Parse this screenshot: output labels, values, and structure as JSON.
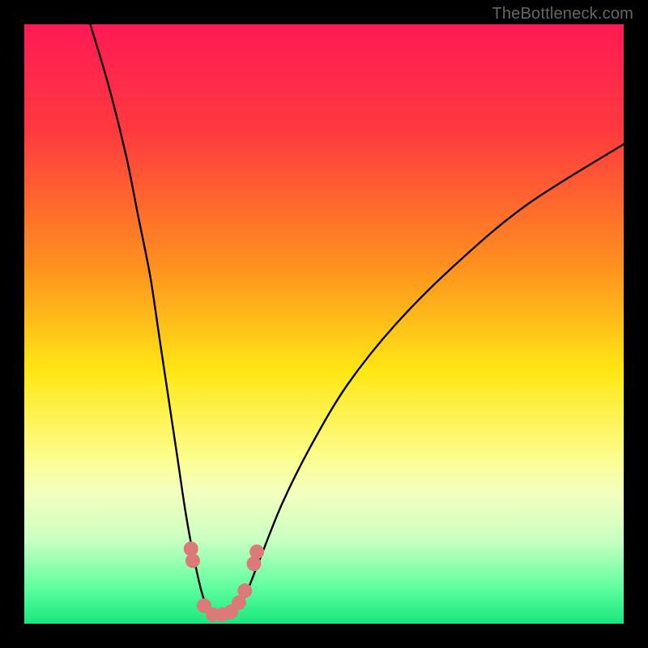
{
  "watermark": "TheBottleneck.com",
  "chart_data": {
    "type": "line",
    "title": "",
    "xlabel": "",
    "ylabel": "",
    "xlim": [
      0,
      100
    ],
    "ylim": [
      0,
      100
    ],
    "gradient_stops": [
      {
        "offset": 0,
        "color": "#ff1a55"
      },
      {
        "offset": 18,
        "color": "#ff3a3f"
      },
      {
        "offset": 40,
        "color": "#ff8f1f"
      },
      {
        "offset": 58,
        "color": "#ffe714"
      },
      {
        "offset": 72,
        "color": "#fdfd8a"
      },
      {
        "offset": 78,
        "color": "#f4ffbf"
      },
      {
        "offset": 86,
        "color": "#caffc2"
      },
      {
        "offset": 94,
        "color": "#5eff9d"
      },
      {
        "offset": 100,
        "color": "#17e87c"
      }
    ],
    "series": [
      {
        "name": "bottleneck-curve",
        "points": [
          {
            "x": 11.0,
            "y": 100.0
          },
          {
            "x": 14.0,
            "y": 90.0
          },
          {
            "x": 17.0,
            "y": 78.0
          },
          {
            "x": 19.0,
            "y": 68.0
          },
          {
            "x": 21.0,
            "y": 58.0
          },
          {
            "x": 22.5,
            "y": 48.0
          },
          {
            "x": 24.0,
            "y": 38.0
          },
          {
            "x": 25.5,
            "y": 28.0
          },
          {
            "x": 27.0,
            "y": 18.0
          },
          {
            "x": 28.5,
            "y": 10.0
          },
          {
            "x": 30.0,
            "y": 4.0
          },
          {
            "x": 32.0,
            "y": 1.0
          },
          {
            "x": 34.0,
            "y": 1.0
          },
          {
            "x": 36.5,
            "y": 4.0
          },
          {
            "x": 39.0,
            "y": 10.0
          },
          {
            "x": 43.0,
            "y": 20.0
          },
          {
            "x": 48.0,
            "y": 30.0
          },
          {
            "x": 54.0,
            "y": 40.0
          },
          {
            "x": 62.0,
            "y": 50.0
          },
          {
            "x": 72.0,
            "y": 60.0
          },
          {
            "x": 84.0,
            "y": 70.0
          },
          {
            "x": 100.0,
            "y": 80.0
          }
        ]
      }
    ],
    "markers": [
      {
        "x": 27.8,
        "y": 12.5
      },
      {
        "x": 28.1,
        "y": 10.5
      },
      {
        "x": 30.0,
        "y": 3.0
      },
      {
        "x": 31.5,
        "y": 1.5
      },
      {
        "x": 33.0,
        "y": 1.5
      },
      {
        "x": 34.5,
        "y": 2.0
      },
      {
        "x": 35.8,
        "y": 3.5
      },
      {
        "x": 36.8,
        "y": 5.5
      },
      {
        "x": 38.3,
        "y": 10.0
      },
      {
        "x": 38.8,
        "y": 12.0
      }
    ]
  }
}
